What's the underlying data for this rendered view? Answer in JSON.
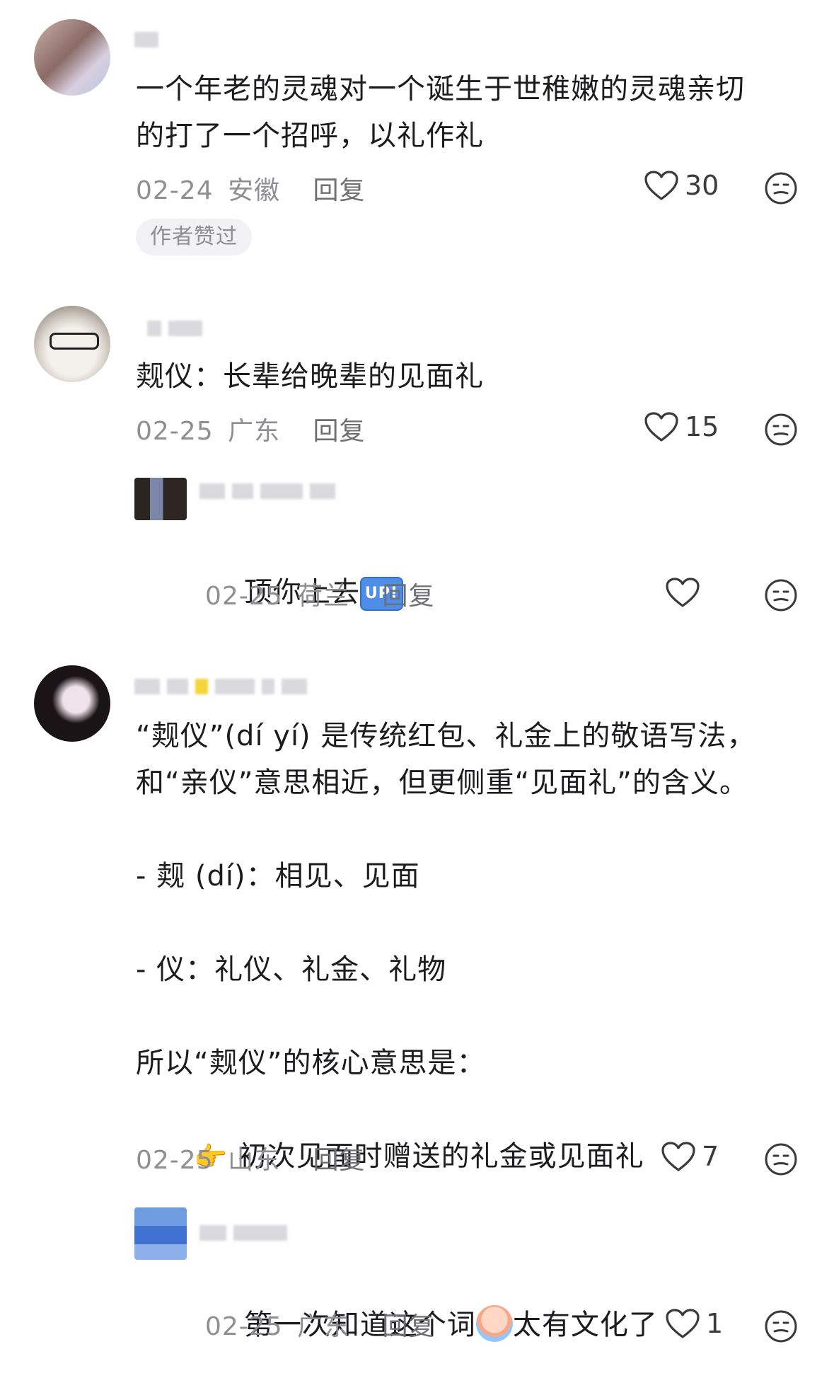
{
  "comments": [
    {
      "text": "一个年老的灵魂对一个诞生于世稚嫩的灵魂亲切\n的打了一个招呼，以礼作礼",
      "date": "02-24",
      "location": "安徽",
      "reply_label": "回复",
      "likes": "30",
      "author_badge": "作者赞过"
    },
    {
      "text": "觌仪：长辈给晚辈的见面礼",
      "date": "02-25",
      "location": "广东",
      "reply_label": "回复",
      "likes": "15",
      "reply": {
        "text": "顶你上去",
        "badge": "UP!",
        "date": "02-25",
        "location": "荷兰",
        "reply_label": "回复"
      }
    },
    {
      "line1": "“觌仪”(dí yí) 是传统红包、礼金上的敬语写法，",
      "line2": "和“亲仪”意思相近，但更侧重“见面礼”的含义。",
      "line3": "- 觌 (dí)：相见、见面",
      "line4": "- 仪：礼仪、礼金、礼物",
      "line5": "所以“觌仪”的核心意思是：",
      "line6": "初次见面时赠送的礼金或见面礼",
      "date": "02-25",
      "location": "山东",
      "reply_label": "回复",
      "likes": "7",
      "reply": {
        "text_before": "第一次知道这个词",
        "text_after": "太有文化了",
        "date": "02-25",
        "location": "广东",
        "reply_label": "回复",
        "likes": "1"
      }
    }
  ],
  "colors": {
    "meta": "#8e8e93",
    "text": "#1c1c1e",
    "badge_bg": "#f2f2f4",
    "up_badge": "#4f8ee8"
  }
}
